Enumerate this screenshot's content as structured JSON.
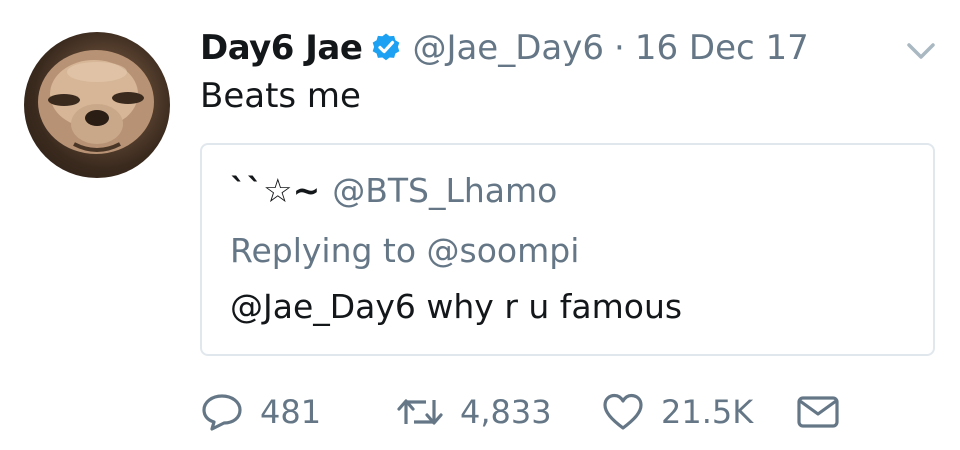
{
  "tweet": {
    "author": {
      "display_name": "Day6 Jae",
      "handle": "@Jae_Day6",
      "verified": true,
      "avatar_icon": "avatar-image"
    },
    "separator": "·",
    "date": "16 Dec 17",
    "text": "Beats me",
    "menu_icon": "chevron-down-icon",
    "quoted": {
      "display_name": "``☆~",
      "handle": "@BTS_Lhamo",
      "replying_to": "Replying to @soompi",
      "text": "@Jae_Day6 why r u famous"
    },
    "actions": {
      "replies": "481",
      "retweets": "4,833",
      "likes": "21.5K"
    }
  },
  "colors": {
    "text_primary": "#14171a",
    "text_secondary": "#657786",
    "verified_blue": "#1da1f2",
    "border": "#e1e8ed"
  }
}
